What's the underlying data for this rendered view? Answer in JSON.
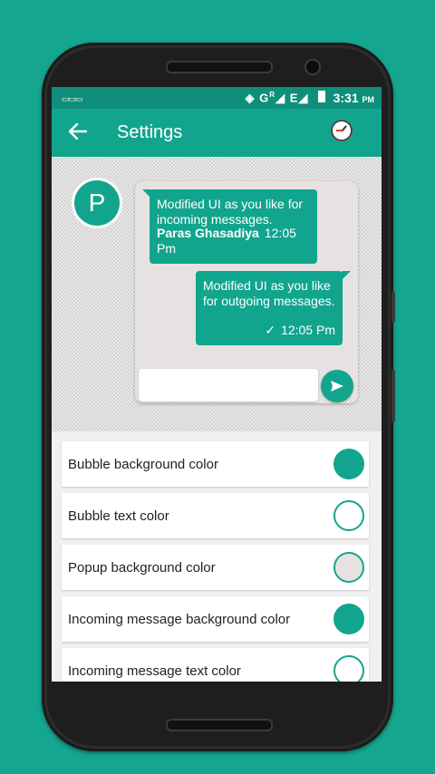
{
  "statusbar": {
    "keyboard_icon": "keyboard-icon",
    "network_text": "G",
    "network_sup": "R",
    "e_text": "E",
    "time": "3:31",
    "ampm": "PM"
  },
  "appbar": {
    "title": "Settings",
    "back_icon": "arrow-back-icon",
    "action_icon": "clock-icon"
  },
  "preview": {
    "avatar_letter": "P",
    "incoming": {
      "text": "Modified UI as you like for incoming messages.",
      "sender": "Paras Ghasadiya",
      "time": "12:05 Pm"
    },
    "outgoing": {
      "text": "Modified UI as you like for outgoing messages.",
      "time": "12:05 Pm"
    },
    "compose_placeholder": ""
  },
  "settings": [
    {
      "label": "Bubble background color",
      "swatch": "#12a58e"
    },
    {
      "label": "Bubble text color",
      "swatch": "#ffffff"
    },
    {
      "label": "Popup background color",
      "swatch": "#e6e2e1"
    },
    {
      "label": "Incoming message background color",
      "swatch": "#12a58e"
    },
    {
      "label": "Incoming message text color",
      "swatch": "#ffffff"
    }
  ],
  "colors": {
    "accent": "#12a58e",
    "statusbar": "#0f8f7b",
    "background": "#15a68f"
  }
}
